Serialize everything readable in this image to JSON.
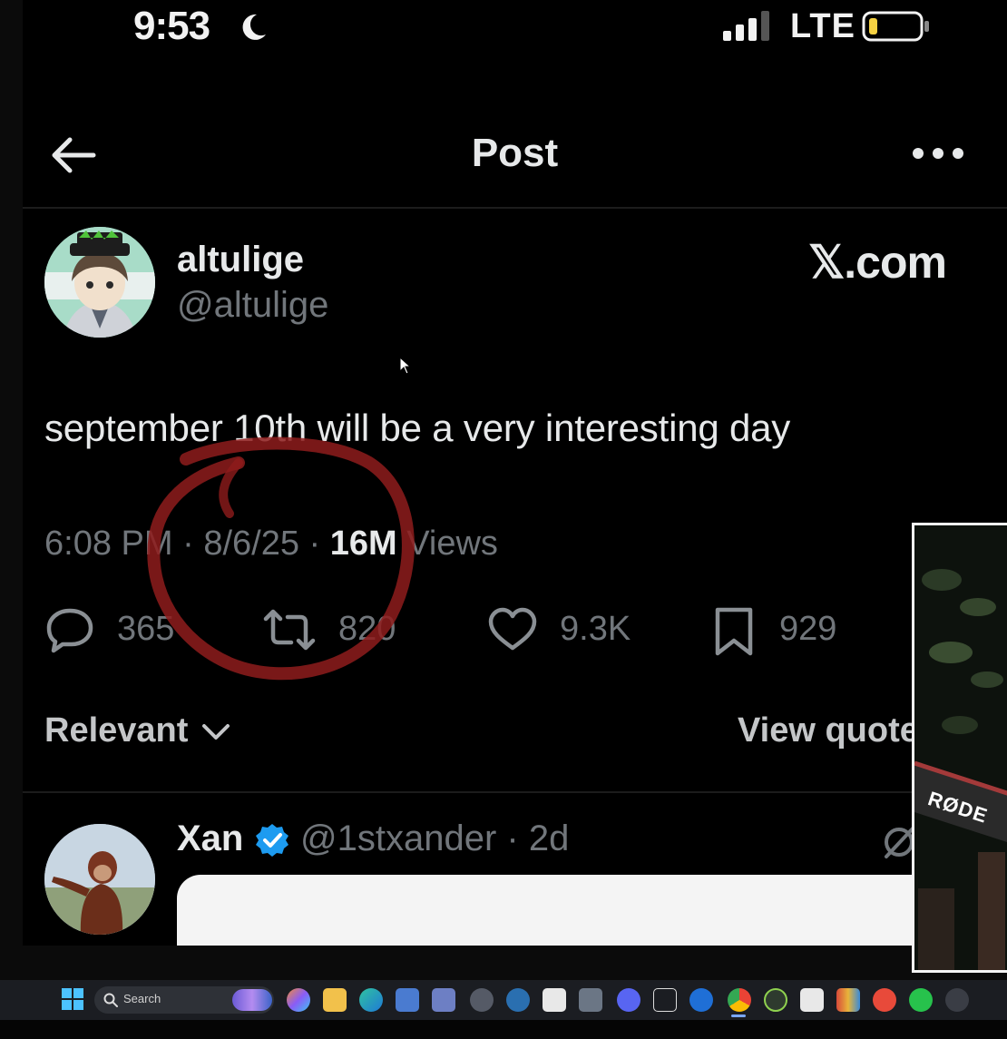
{
  "status_bar": {
    "time": "9:53",
    "network": "LTE"
  },
  "nav": {
    "title": "Post"
  },
  "post": {
    "author_name": "altulige",
    "author_handle": "@altulige",
    "watermark": "𝕏.com",
    "text": "september 10th will be a very interesting day",
    "time": "6:08 PM",
    "date": "8/6/25",
    "views_count": "16M",
    "views_label": "Views",
    "replies": "365",
    "reposts": "820",
    "likes": "9.3K",
    "bookmarks": "929"
  },
  "replies_bar": {
    "sort_label": "Relevant",
    "view_quotes_label": "View quote"
  },
  "reply": {
    "name": "Xan",
    "handle": "@1stxander",
    "age": "2d"
  },
  "webcam": {
    "mic_brand": "RØDE"
  },
  "taskbar": {
    "search_placeholder": "Search"
  },
  "colors": {
    "background": "#000000",
    "text_primary": "#e7e9ea",
    "text_secondary": "#71767b",
    "verified_blue": "#1d9bf0",
    "scribble_red": "#8e1c1c"
  }
}
